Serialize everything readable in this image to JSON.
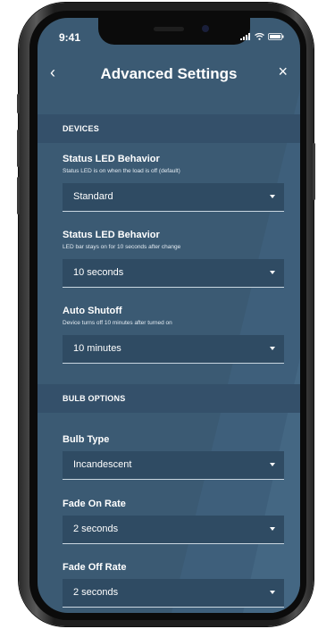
{
  "status_bar": {
    "time": "9:41"
  },
  "header": {
    "title": "Advanced Settings"
  },
  "sections": {
    "devices": {
      "title": "DEVICES"
    },
    "bulb_options": {
      "title": "BULB OPTIONS"
    }
  },
  "settings": [
    {
      "label": "Status LED Behavior",
      "description": "Status LED is on when the load is off (default)",
      "value": "Standard"
    },
    {
      "label": "Status LED Behavior",
      "description": "LED bar stays on for 10 seconds after change",
      "value": "10 seconds"
    },
    {
      "label": "Auto Shutoff",
      "description": "Device turns off 10 minutes after turned on",
      "value": "10 minutes"
    },
    {
      "label": "Bulb Type",
      "value": "Incandescent"
    },
    {
      "label": "Fade On Rate",
      "value": "2 seconds"
    },
    {
      "label": "Fade Off Rate",
      "value": "2 seconds"
    }
  ],
  "colors": {
    "background": "#3b5a73",
    "section_header": "#34506a",
    "dropdown": "#2f4b63"
  }
}
